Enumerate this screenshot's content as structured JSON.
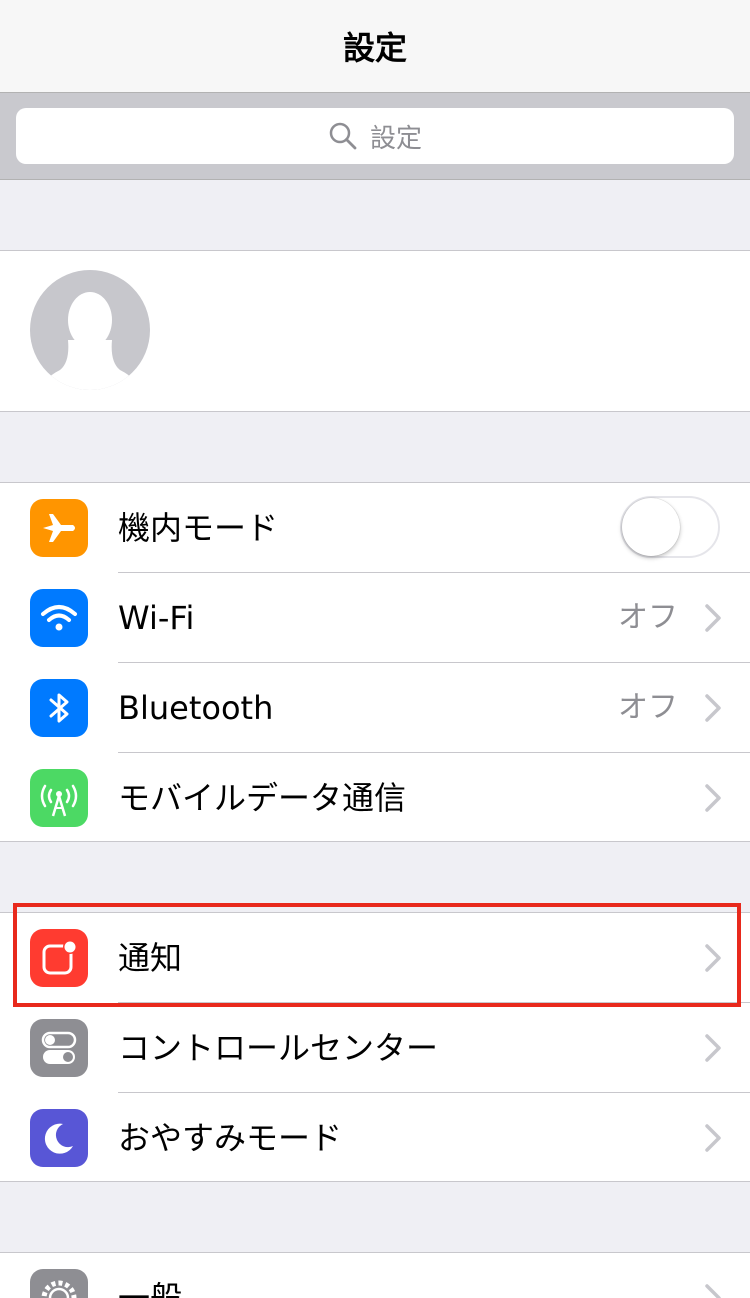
{
  "nav": {
    "title": "設定"
  },
  "search": {
    "placeholder": "設定"
  },
  "groups": {
    "connectivity": [
      {
        "label": "機内モード",
        "icon": "airplane-icon",
        "color": "#ff9500"
      },
      {
        "label": "Wi-Fi",
        "value": "オフ",
        "icon": "wifi-icon",
        "color": "#007aff"
      },
      {
        "label": "Bluetooth",
        "value": "オフ",
        "icon": "bluetooth-icon",
        "color": "#007aff"
      },
      {
        "label": "モバイルデータ通信",
        "icon": "antenna-icon",
        "color": "#4cd964"
      }
    ],
    "notifications": [
      {
        "label": "通知",
        "icon": "notification-icon",
        "color": "#ff3b30"
      },
      {
        "label": "コントロールセンター",
        "icon": "control-center-icon",
        "color": "#8e8e93"
      },
      {
        "label": "おやすみモード",
        "icon": "moon-icon",
        "color": "#5856d6"
      }
    ],
    "general": [
      {
        "label": "一般",
        "icon": "gear-icon",
        "color": "#8e8e93"
      }
    ]
  },
  "highlight_color": "#e8291c"
}
